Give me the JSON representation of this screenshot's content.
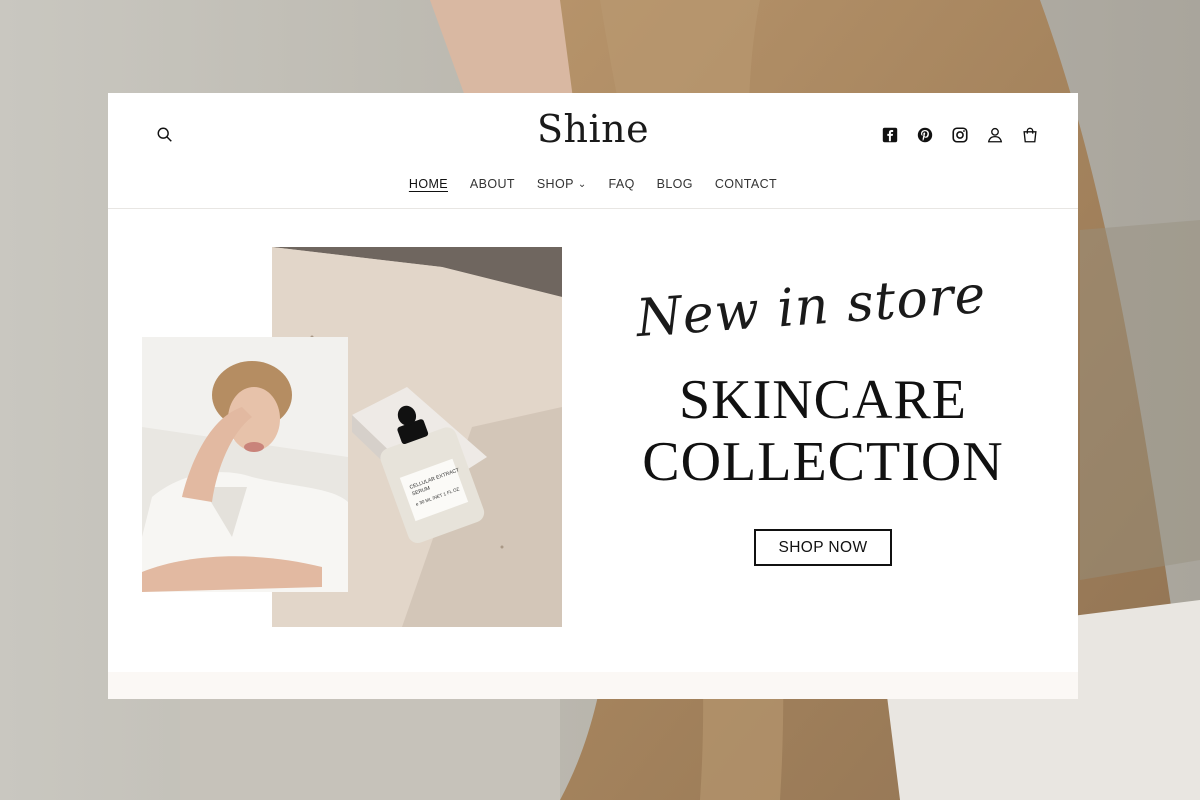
{
  "site": {
    "logo": "Shine",
    "nav": [
      {
        "label": "HOME",
        "active": true
      },
      {
        "label": "ABOUT",
        "active": false
      },
      {
        "label": "SHOP",
        "active": false,
        "has_dropdown": true
      },
      {
        "label": "FAQ",
        "active": false
      },
      {
        "label": "BLOG",
        "active": false
      },
      {
        "label": "CONTACT",
        "active": false
      }
    ],
    "header_icons": [
      "search-icon",
      "facebook-icon",
      "pinterest-icon",
      "instagram-icon",
      "account-icon",
      "cart-icon"
    ]
  },
  "hero": {
    "tagline": "New in store",
    "headline_line1": "SKINCARE",
    "headline_line2": "COLLECTION",
    "cta_label": "SHOP NOW",
    "product_label_line1": "CELLULAR EXTRACT",
    "product_label_line2": "SERUM",
    "product_label_line3": "e 30 ML /NET 1 FL OZ"
  },
  "colors": {
    "background": "#ffffff",
    "text": "#111111",
    "backdrop": "#b8b4ab"
  }
}
